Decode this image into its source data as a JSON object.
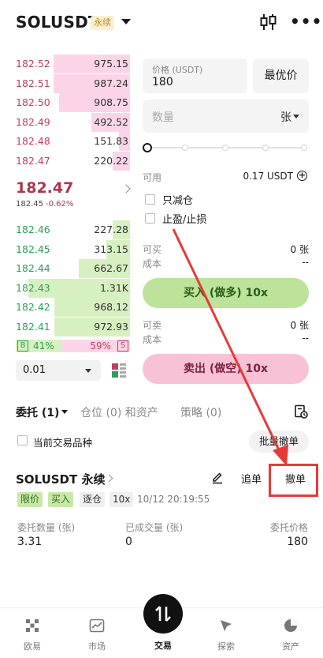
{
  "header": {
    "symbol": "SOLUSDT",
    "badge": "永续",
    "icons": {
      "dropdown": "caret-down-icon",
      "chart": "candlestick-icon",
      "more": "more-icon"
    }
  },
  "orderbook": {
    "col_headers": [
      "(T)",
      "(T)"
    ],
    "asks": [
      {
        "price": "182.52",
        "qty": "975.15",
        "depth": 0.67
      },
      {
        "price": "182.51",
        "qty": "987.24",
        "depth": 0.67
      },
      {
        "price": "182.50",
        "qty": "908.75",
        "depth": 0.62
      },
      {
        "price": "182.49",
        "qty": "492.52",
        "depth": 0.34
      },
      {
        "price": "182.48",
        "qty": "151.83",
        "depth": 0.1
      },
      {
        "price": "182.47",
        "qty": "220.22",
        "depth": 0.15
      }
    ],
    "last_price": "182.47",
    "mark_price": "182.45",
    "change": "-0.62%",
    "bids": [
      {
        "price": "182.46",
        "qty": "227.28",
        "depth": 0.15
      },
      {
        "price": "182.45",
        "qty": "313.15",
        "depth": 0.21
      },
      {
        "price": "182.44",
        "qty": "662.67",
        "depth": 0.45
      },
      {
        "price": "182.43",
        "qty": "1.31K",
        "depth": 0.89
      },
      {
        "price": "182.42",
        "qty": "968.12",
        "depth": 0.66
      },
      {
        "price": "182.41",
        "qty": "972.93",
        "depth": 0.66
      }
    ],
    "buy_tag": "B",
    "buy_pct": "41%",
    "sell_pct": "59%",
    "sell_tag": "S",
    "buy_ratio": 0.41,
    "precision": "0.01"
  },
  "form": {
    "price_label": "价格 (USDT)",
    "price_value": "180",
    "best_price": "最优价",
    "qty_placeholder": "数量",
    "qty_unit": "张",
    "available_label": "可用",
    "available_value": "0.17 USDT",
    "reduce_only": "只减仓",
    "tp_sl": "止盈/止损",
    "can_buy_label": "可买",
    "can_buy_value": "0 张",
    "cost_label_1": "成本",
    "cost_value_1": "--",
    "buy_button": "买入 (做多) 10x",
    "can_sell_label": "可卖",
    "can_sell_value": "0 张",
    "cost_label_2": "成本",
    "cost_value_2": "--",
    "sell_button": "卖出 (做空) 10x"
  },
  "tabs": {
    "orders": "委托 (1)",
    "positions": "仓位 (0) 和资产",
    "strategies": "策略 (0)"
  },
  "filter": {
    "current_only": "当前交易品种",
    "batch_cancel": "批量撤单"
  },
  "order": {
    "symbol": "SOLUSDT 永续",
    "chase": "追单",
    "cancel": "撤单",
    "tag_limit": "限价",
    "tag_buy": "买入",
    "tag_iso": "逐仓",
    "tag_lev": "10x",
    "time": "10/12 20:19:55",
    "qty_label": "委托数量 (张)",
    "qty_value": "3.31",
    "filled_label": "已成交量 (张)",
    "filled_value": "0",
    "price_label": "委托价格",
    "price_value": "180"
  },
  "nav": {
    "items": [
      {
        "label": "欧易",
        "icon": "okx-logo-icon"
      },
      {
        "label": "市场",
        "icon": "chart-line-icon"
      },
      {
        "label": "交易",
        "icon": "trade-arrows-icon"
      },
      {
        "label": "探索",
        "icon": "compass-icon"
      },
      {
        "label": "资产",
        "icon": "pie-chart-icon"
      }
    ]
  },
  "colors": {
    "ask": "#c33d5e",
    "bid": "#2f9e57",
    "ask_depth": "#fbd5e7",
    "bid_depth": "#d7f0c2",
    "buy_button": "#bde39a",
    "sell_button": "#f9c1d6",
    "highlight": "#e63a3a"
  }
}
